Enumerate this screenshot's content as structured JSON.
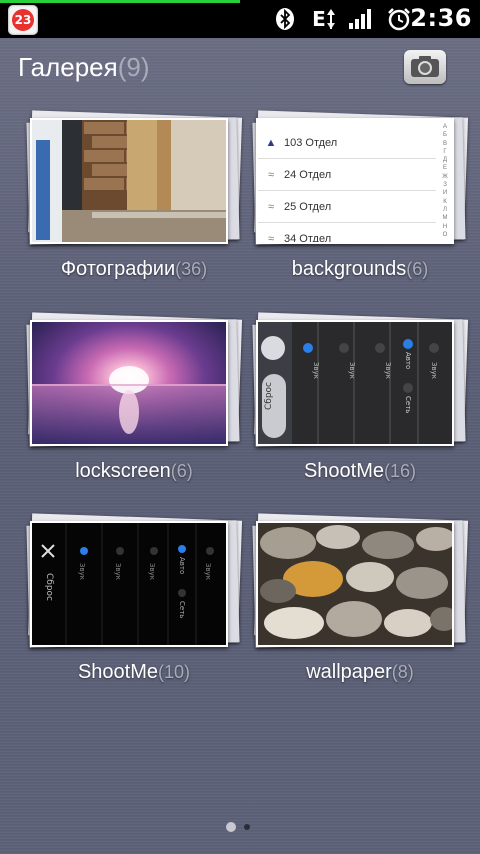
{
  "status_bar": {
    "notification_count": "23",
    "network_type": "E",
    "time": "2:36",
    "download_progress": 0.5,
    "icons": [
      "notification-badge-icon",
      "bluetooth-icon",
      "data-arrows-icon",
      "signal-icon",
      "alarm-icon"
    ]
  },
  "header": {
    "title": "Галерея",
    "count": "(9)",
    "camera_icon": "camera-icon"
  },
  "albums": [
    {
      "name": "Фотографии",
      "count": "(36)"
    },
    {
      "name": "backgrounds",
      "count": "(6)"
    },
    {
      "name": "lockscreen",
      "count": "(6)"
    },
    {
      "name": "ShootMe",
      "count": "(16)"
    },
    {
      "name": "ShootMe",
      "count": "(10)"
    },
    {
      "name": "wallpaper",
      "count": "(8)"
    }
  ],
  "backgrounds_thumb": {
    "rows": [
      "103 Отдел",
      "24 Отдел",
      "25 Отдел",
      "34 Отдел"
    ]
  },
  "shootme_thumb": {
    "side_label": "Сброс",
    "col_label": "Звук",
    "auto_label": "Авто",
    "row_label": "Сеть"
  },
  "pager": {
    "current_page": 1,
    "total_pages": 2
  },
  "colors": {
    "background": "#5d6177",
    "badge_red": "#e8322f",
    "progress_green": "#28d03a",
    "count_gray": "#a9abb9"
  }
}
